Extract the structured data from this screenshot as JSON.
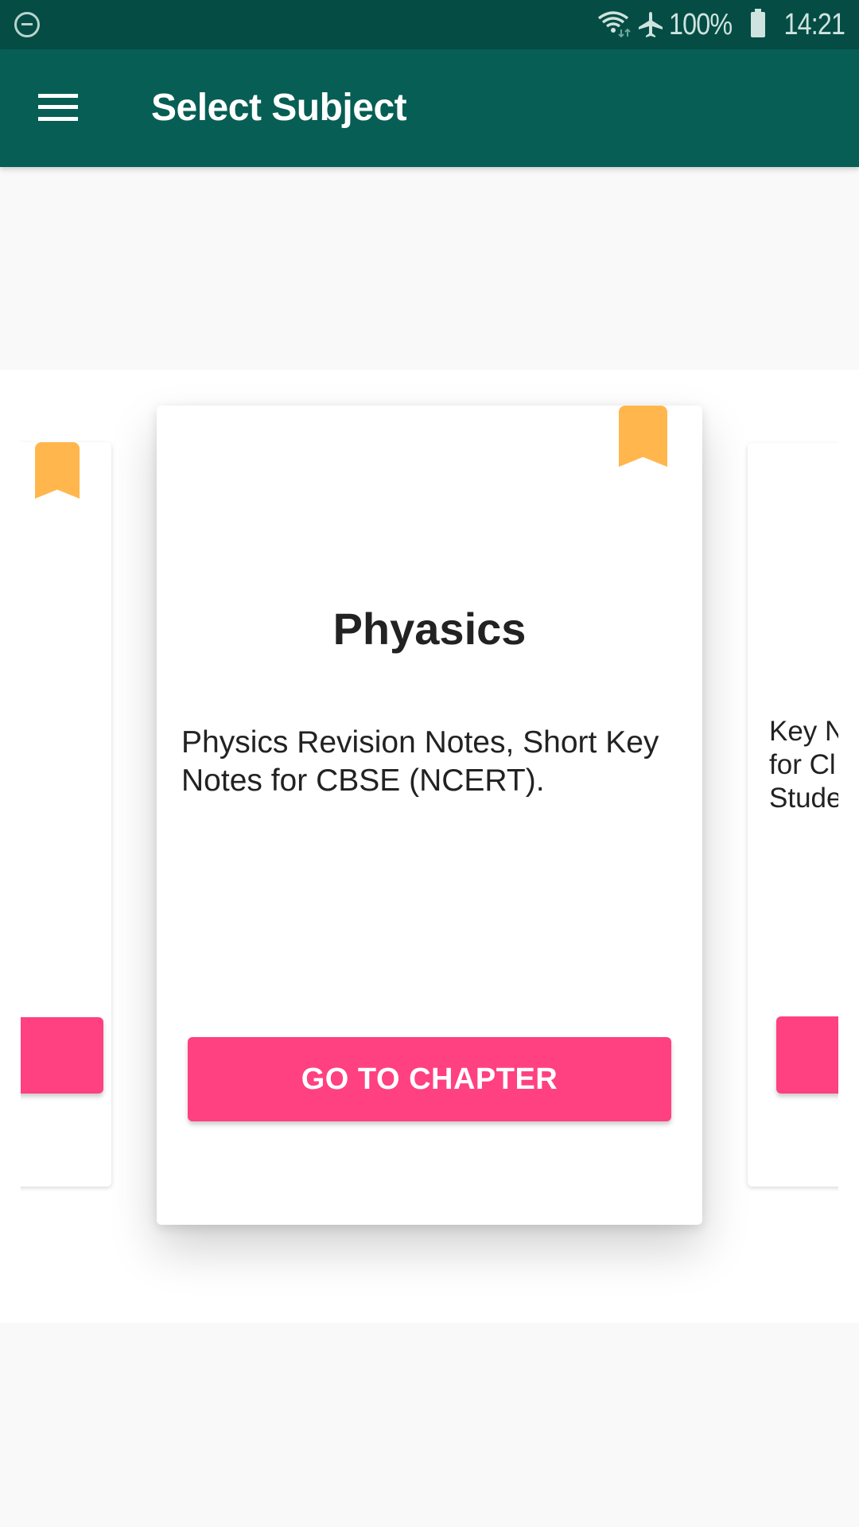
{
  "status_bar": {
    "dnd_icon": "do-not-disturb-icon",
    "wifi_icon": "wifi-icon",
    "airplane_icon": "airplane-icon",
    "battery_percent": "100%",
    "battery_icon": "battery-full-icon",
    "time": "14:21"
  },
  "app_bar": {
    "menu_icon": "hamburger-menu-icon",
    "title": "Select Subject"
  },
  "colors": {
    "status_bar": "#054d44",
    "app_bar": "#075e54",
    "accent_button": "#ff4081",
    "bookmark": "#ffb74d",
    "background": "#f9f9f9"
  },
  "carousel": {
    "cards": [
      {
        "position": "left",
        "title": "",
        "description": "",
        "button_label": ""
      },
      {
        "position": "center",
        "title": "Phyasics",
        "description": "Physics Revision Notes, Short Key Notes for CBSE (NCERT).",
        "button_label": "GO TO CHAPTER"
      },
      {
        "position": "right",
        "title": "",
        "description": "Key N\nfor Cl\nStude",
        "button_label": ""
      }
    ]
  }
}
